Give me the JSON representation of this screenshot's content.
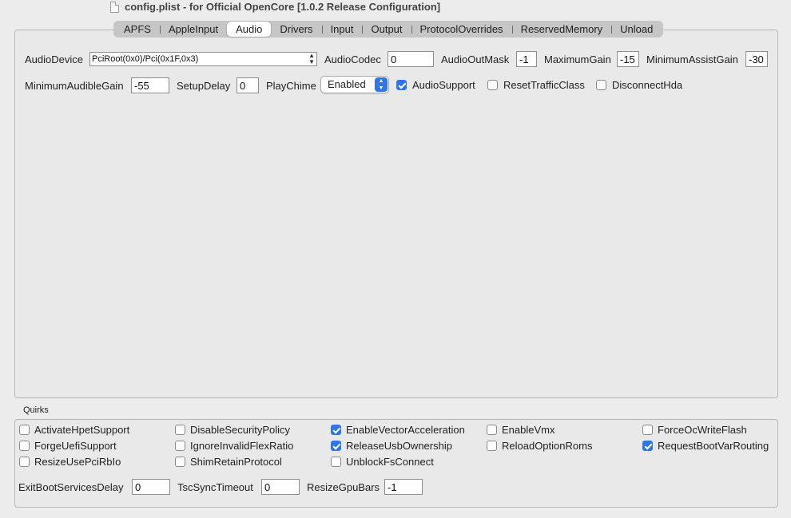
{
  "window": {
    "title": "config.plist - for Official OpenCore [1.0.2 Release Configuration]"
  },
  "tabs": [
    "APFS",
    "AppleInput",
    "Audio",
    "Drivers",
    "Input",
    "Output",
    "ProtocolOverrides",
    "ReservedMemory",
    "Unload"
  ],
  "active_tab": "Audio",
  "audio": {
    "audio_device_label": "AudioDevice",
    "audio_device_value": "PciRoot(0x0)/Pci(0x1F,0x3)",
    "audio_codec_label": "AudioCodec",
    "audio_codec_value": "0",
    "audio_out_mask_label": "AudioOutMask",
    "audio_out_mask_value": "-1",
    "maximum_gain_label": "MaximumGain",
    "maximum_gain_value": "-15",
    "minimum_assist_gain_label": "MinimumAssistGain",
    "minimum_assist_gain_value": "-30",
    "minimum_audible_gain_label": "MinimumAudibleGain",
    "minimum_audible_gain_value": "-55",
    "setup_delay_label": "SetupDelay",
    "setup_delay_value": "0",
    "play_chime_label": "PlayChime",
    "play_chime_value": "Enabled",
    "audio_support_label": "AudioSupport",
    "audio_support_checked": true,
    "reset_traffic_class_label": "ResetTrafficClass",
    "reset_traffic_class_checked": false,
    "disconnect_hda_label": "DisconnectHda",
    "disconnect_hda_checked": false
  },
  "quirks": {
    "title": "Quirks",
    "items": [
      {
        "label": "ActivateHpetSupport",
        "checked": false
      },
      {
        "label": "DisableSecurityPolicy",
        "checked": false
      },
      {
        "label": "EnableVectorAcceleration",
        "checked": true
      },
      {
        "label": "EnableVmx",
        "checked": false
      },
      {
        "label": "ForceOcWriteFlash",
        "checked": false
      },
      {
        "label": "ForgeUefiSupport",
        "checked": false
      },
      {
        "label": "IgnoreInvalidFlexRatio",
        "checked": false
      },
      {
        "label": "ReleaseUsbOwnership",
        "checked": true
      },
      {
        "label": "ReloadOptionRoms",
        "checked": false
      },
      {
        "label": "RequestBootVarRouting",
        "checked": true
      },
      {
        "label": "ResizeUsePciRbIo",
        "checked": false
      },
      {
        "label": "ShimRetainProtocol",
        "checked": false
      },
      {
        "label": "UnblockFsConnect",
        "checked": false
      }
    ],
    "exit_boot_services_delay_label": "ExitBootServicesDelay",
    "exit_boot_services_delay_value": "0",
    "tsc_sync_timeout_label": "TscSyncTimeout",
    "tsc_sync_timeout_value": "0",
    "resize_gpu_bars_label": "ResizeGpuBars",
    "resize_gpu_bars_value": "-1"
  },
  "colors": {
    "accent": "#2f76e8",
    "panel_bg": "#e9e9e9",
    "window_bg": "#ececec"
  }
}
